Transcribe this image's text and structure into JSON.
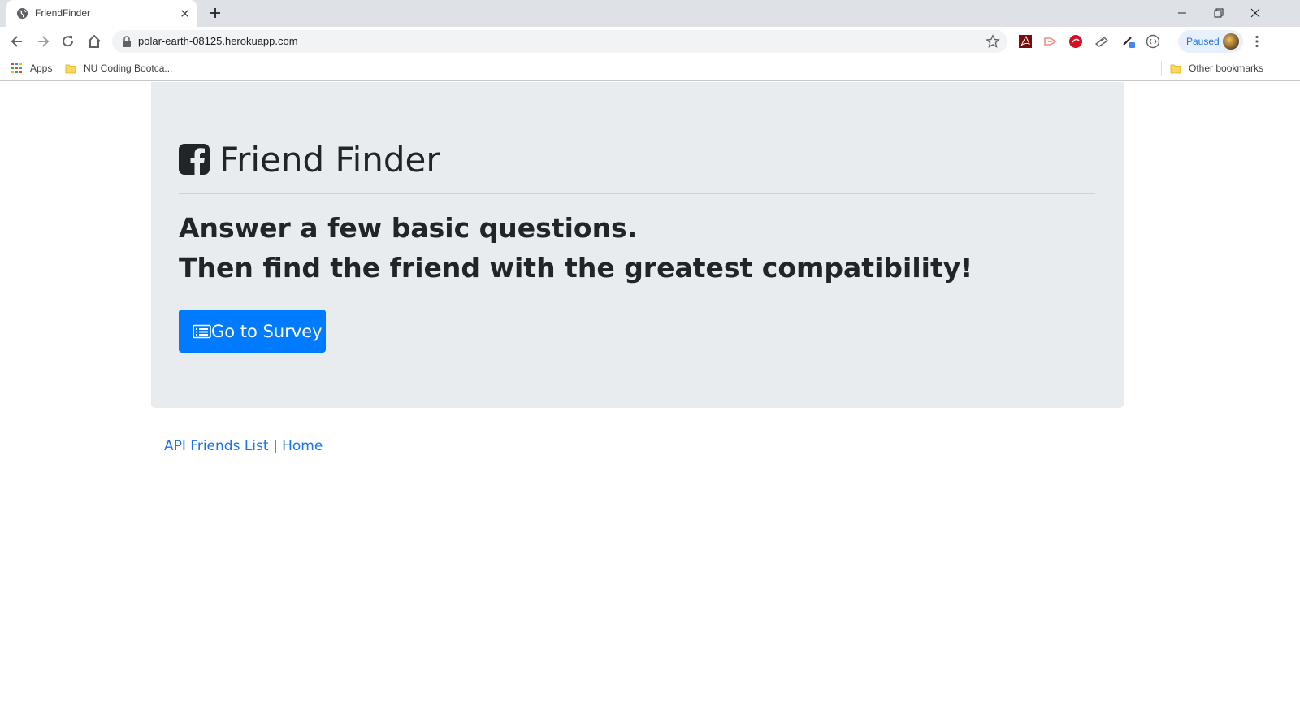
{
  "browser": {
    "tab_title": "FriendFinder",
    "url": "polar-earth-08125.herokuapp.com",
    "profile_label": "Paused",
    "bookmarks": {
      "apps_label": "Apps",
      "folder_label": "NU Coding Bootca...",
      "other_label": "Other bookmarks"
    }
  },
  "page": {
    "title": "Friend Finder",
    "lead_line1": "Answer a few basic questions.",
    "lead_line2": "Then find the friend with the greatest compatibility!",
    "survey_button_label": "Go to Survey",
    "footer": {
      "api_link_label": "API Friends List",
      "separator": "|",
      "home_link_label": "Home"
    }
  },
  "colors": {
    "primary_button": "#007bff",
    "jumbotron_bg": "#e9ecef",
    "link": "#1a73e8",
    "text": "#212529"
  },
  "icons": [
    "globe-icon",
    "close-icon",
    "plus-icon",
    "back-icon",
    "forward-icon",
    "reload-icon",
    "home-icon",
    "lock-icon",
    "star-icon",
    "facebook-square-icon",
    "list-alt-icon"
  ]
}
